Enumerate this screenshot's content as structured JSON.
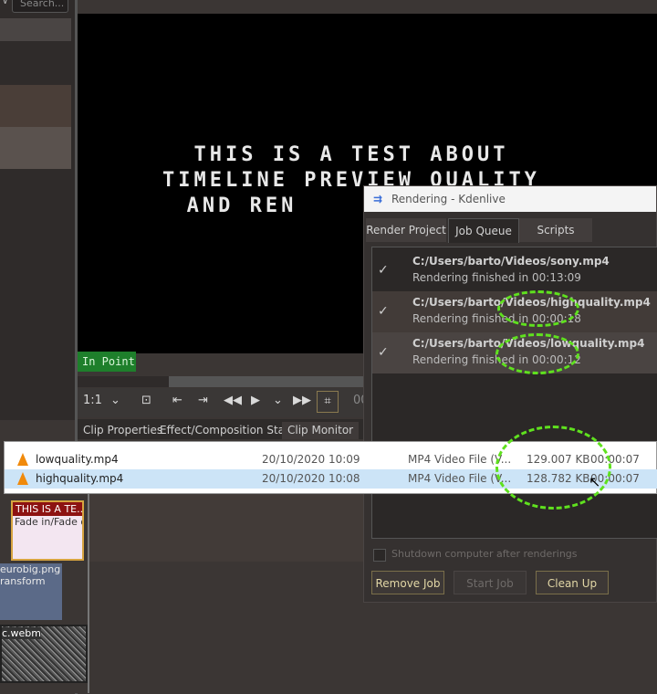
{
  "left_panel": {
    "search_placeholder": "Search..."
  },
  "monitor": {
    "title_lines": [
      "THIS IS A TEST ABOUT",
      "TIMELINE PREVIEW QUALITY",
      "AND REN"
    ],
    "in_point_label": "In Point",
    "zoom": "1:1",
    "timecode_partial": "00"
  },
  "bottom_tabs": [
    "Clip Properties",
    "Effect/Composition Stack",
    "Clip Monitor"
  ],
  "timeline": {
    "clip1_title": "THIS IS A TE...",
    "clip1_effect": "Fade in/Fade o",
    "clip2_title": "eurobig.png",
    "clip2_effect": "ransform",
    "clip3_title": "c.webm"
  },
  "dialog": {
    "title": "Rendering - Kdenlive",
    "tabs": [
      "Render Project",
      "Job Queue",
      "Scripts"
    ],
    "active_tab": "Job Queue",
    "jobs": [
      {
        "path": "C:/Users/barto/Videos/sony.mp4",
        "status": "Rendering finished in 00:13:09"
      },
      {
        "path": "C:/Users/barto/Videos/highquality.mp4",
        "status": "Rendering finished in 00:00:18"
      },
      {
        "path": "C:/Users/barto/Videos/lowquality.mp4",
        "status": "Rendering finished in 00:00:12"
      }
    ],
    "shutdown_label": "Shutdown computer after renderings",
    "buttons": {
      "remove": "Remove Job",
      "start": "Start Job",
      "clean": "Clean Up"
    }
  },
  "explorer": {
    "rows": [
      {
        "name": "lowquality.mp4",
        "date": "20/10/2020 10:09",
        "type": "MP4 Video File (V...",
        "size": "129.007 KB",
        "length": "00:00:07"
      },
      {
        "name": "highquality.mp4",
        "date": "20/10/2020 10:08",
        "type": "MP4 Video File (V...",
        "size": "128.782 KB",
        "length": "00:00:07"
      }
    ]
  },
  "colors": {
    "annotation": "#5fe11e",
    "in_point_bg": "#1e7f2b",
    "selected_row": "#cce4f7"
  }
}
